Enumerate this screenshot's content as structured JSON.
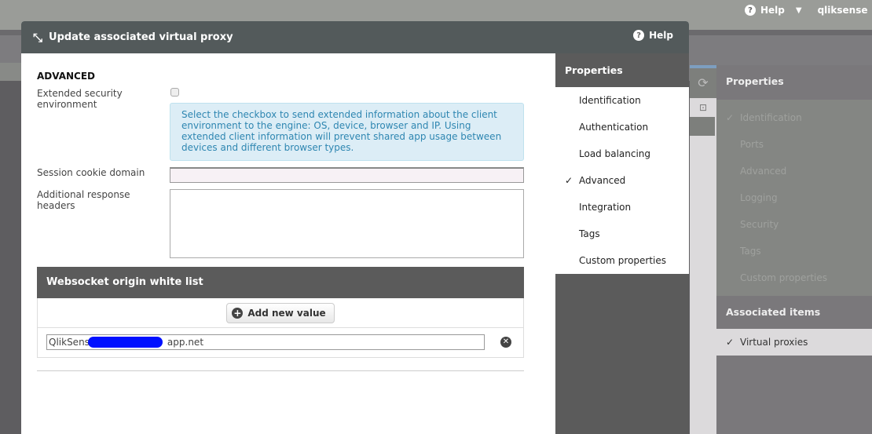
{
  "topbar": {
    "help": "Help",
    "user": "qliksense"
  },
  "modal": {
    "title": "Update associated virtual proxy",
    "help": "Help",
    "section": "ADVANCED",
    "fields": {
      "extended_security_label": "Extended security environment",
      "extended_security_checked": false,
      "info": "Select the checkbox to send extended information about the client environment to the engine: OS, device, browser and IP. Using extended client information will prevent shared app usage between devices and different browser types.",
      "session_cookie_label": "Session cookie domain",
      "session_cookie_value": "",
      "response_headers_label": "Additional response headers",
      "response_headers_value": ""
    },
    "websocket": {
      "title": "Websocket origin white list",
      "add_label": "Add new value",
      "values": [
        {
          "prefix": "QlikSens",
          "suffix": "app.net"
        }
      ]
    },
    "nav": {
      "title": "Properties",
      "items": [
        {
          "label": "Identification",
          "checked": false
        },
        {
          "label": "Authentication",
          "checked": false
        },
        {
          "label": "Load balancing",
          "checked": false
        },
        {
          "label": "Advanced",
          "checked": true
        },
        {
          "label": "Integration",
          "checked": false
        },
        {
          "label": "Tags",
          "checked": false
        },
        {
          "label": "Custom properties",
          "checked": false
        }
      ]
    }
  },
  "background_panel": {
    "properties_title": "Properties",
    "items": [
      {
        "label": "Identification",
        "checked": true
      },
      {
        "label": "Ports"
      },
      {
        "label": "Advanced"
      },
      {
        "label": "Logging"
      },
      {
        "label": "Security"
      },
      {
        "label": "Tags"
      },
      {
        "label": "Custom properties"
      }
    ],
    "associated_title": "Associated items",
    "associated_items": [
      {
        "label": "Virtual proxies",
        "checked": true
      }
    ]
  },
  "check_glyph": "✓"
}
